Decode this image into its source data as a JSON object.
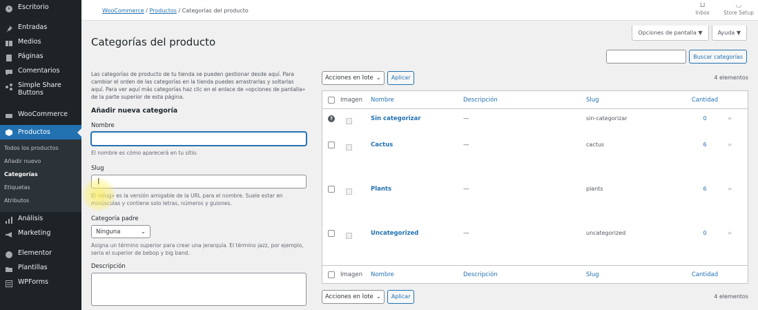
{
  "sidebar": {
    "items": [
      {
        "label": "Escritorio",
        "icon": "dashboard-icon"
      },
      {
        "label": "Entradas",
        "icon": "pin-icon"
      },
      {
        "label": "Medios",
        "icon": "media-icon"
      },
      {
        "label": "Páginas",
        "icon": "pages-icon"
      },
      {
        "label": "Comentarios",
        "icon": "comments-icon"
      },
      {
        "label": "Simple Share Buttons",
        "icon": "share-icon"
      },
      {
        "label": "WooCommerce",
        "icon": "woocommerce-icon"
      },
      {
        "label": "Productos",
        "icon": "products-icon"
      },
      {
        "label": "Análisis",
        "icon": "analytics-icon"
      },
      {
        "label": "Marketing",
        "icon": "megaphone-icon"
      },
      {
        "label": "Elementor",
        "icon": "elementor-icon"
      },
      {
        "label": "Plantillas",
        "icon": "folder-icon"
      },
      {
        "label": "WPForms",
        "icon": "forms-icon"
      }
    ],
    "submenu": [
      "Todos los productos",
      "Añadir nuevo",
      "Categorías",
      "Etiquetas",
      "Atributos"
    ]
  },
  "topbar": {
    "breadcrumb": [
      "WooCommerce",
      "Productos",
      "Categorías del producto"
    ],
    "breadcrumb_sep": "/",
    "inbox_label": "Inbox",
    "store_setup_label": "Store Setup"
  },
  "page": {
    "title": "Categorías del producto",
    "screen_options": "Opciones de pantalla ▼",
    "help": "Ayuda ▼",
    "search_button": "Buscar categorías",
    "search_value": ""
  },
  "form": {
    "intro": "Las categorías de producto de tu tienda se pueden gestionar desde aquí. Para cambiar el orden de las categorías en la tienda puedes arrastrarlas y soltarlas aquí. Para ver aquí más categorías haz clic en el enlace de «opciones de pantalla» de la parte superior de esta página.",
    "title": "Añadir nueva categoría",
    "name_label": "Nombre",
    "name_value": "",
    "name_help": "El nombre es cómo aparecerá en tu sitio.",
    "slug_label": "Slug",
    "slug_value": "",
    "slug_help": "El «slug» es la versión amigable de la URL para el nombre. Suele estar en minúsculas y contiene solo letras, números y guiones.",
    "parent_label": "Categoría padre",
    "parent_value": "Ninguna",
    "parent_help": "Asigna un término superior para crear una jerarquía. El término jazz, por ejemplo, sería el superior de bebop y big band.",
    "description_label": "Descripción"
  },
  "table": {
    "bulk_label": "Acciones en lote",
    "apply_label": "Aplicar",
    "count_label": "4 elementos",
    "columns": {
      "image": "Imagen",
      "name": "Nombre",
      "description": "Descripción",
      "slug": "Slug",
      "count": "Cantidad"
    },
    "rows": [
      {
        "name": "Sin categorizar",
        "description": "—",
        "slug": "sin-categorizar",
        "count": "0"
      },
      {
        "name": "Cactus",
        "description": "—",
        "slug": "cactus",
        "count": "6"
      },
      {
        "name": "Plants",
        "description": "—",
        "slug": "plants",
        "count": "6"
      },
      {
        "name": "Uncategorized",
        "description": "—",
        "slug": "uncategorized",
        "count": "0"
      }
    ]
  },
  "colors": {
    "accent": "#2271b1",
    "sidebar_bg": "#1d2327"
  }
}
